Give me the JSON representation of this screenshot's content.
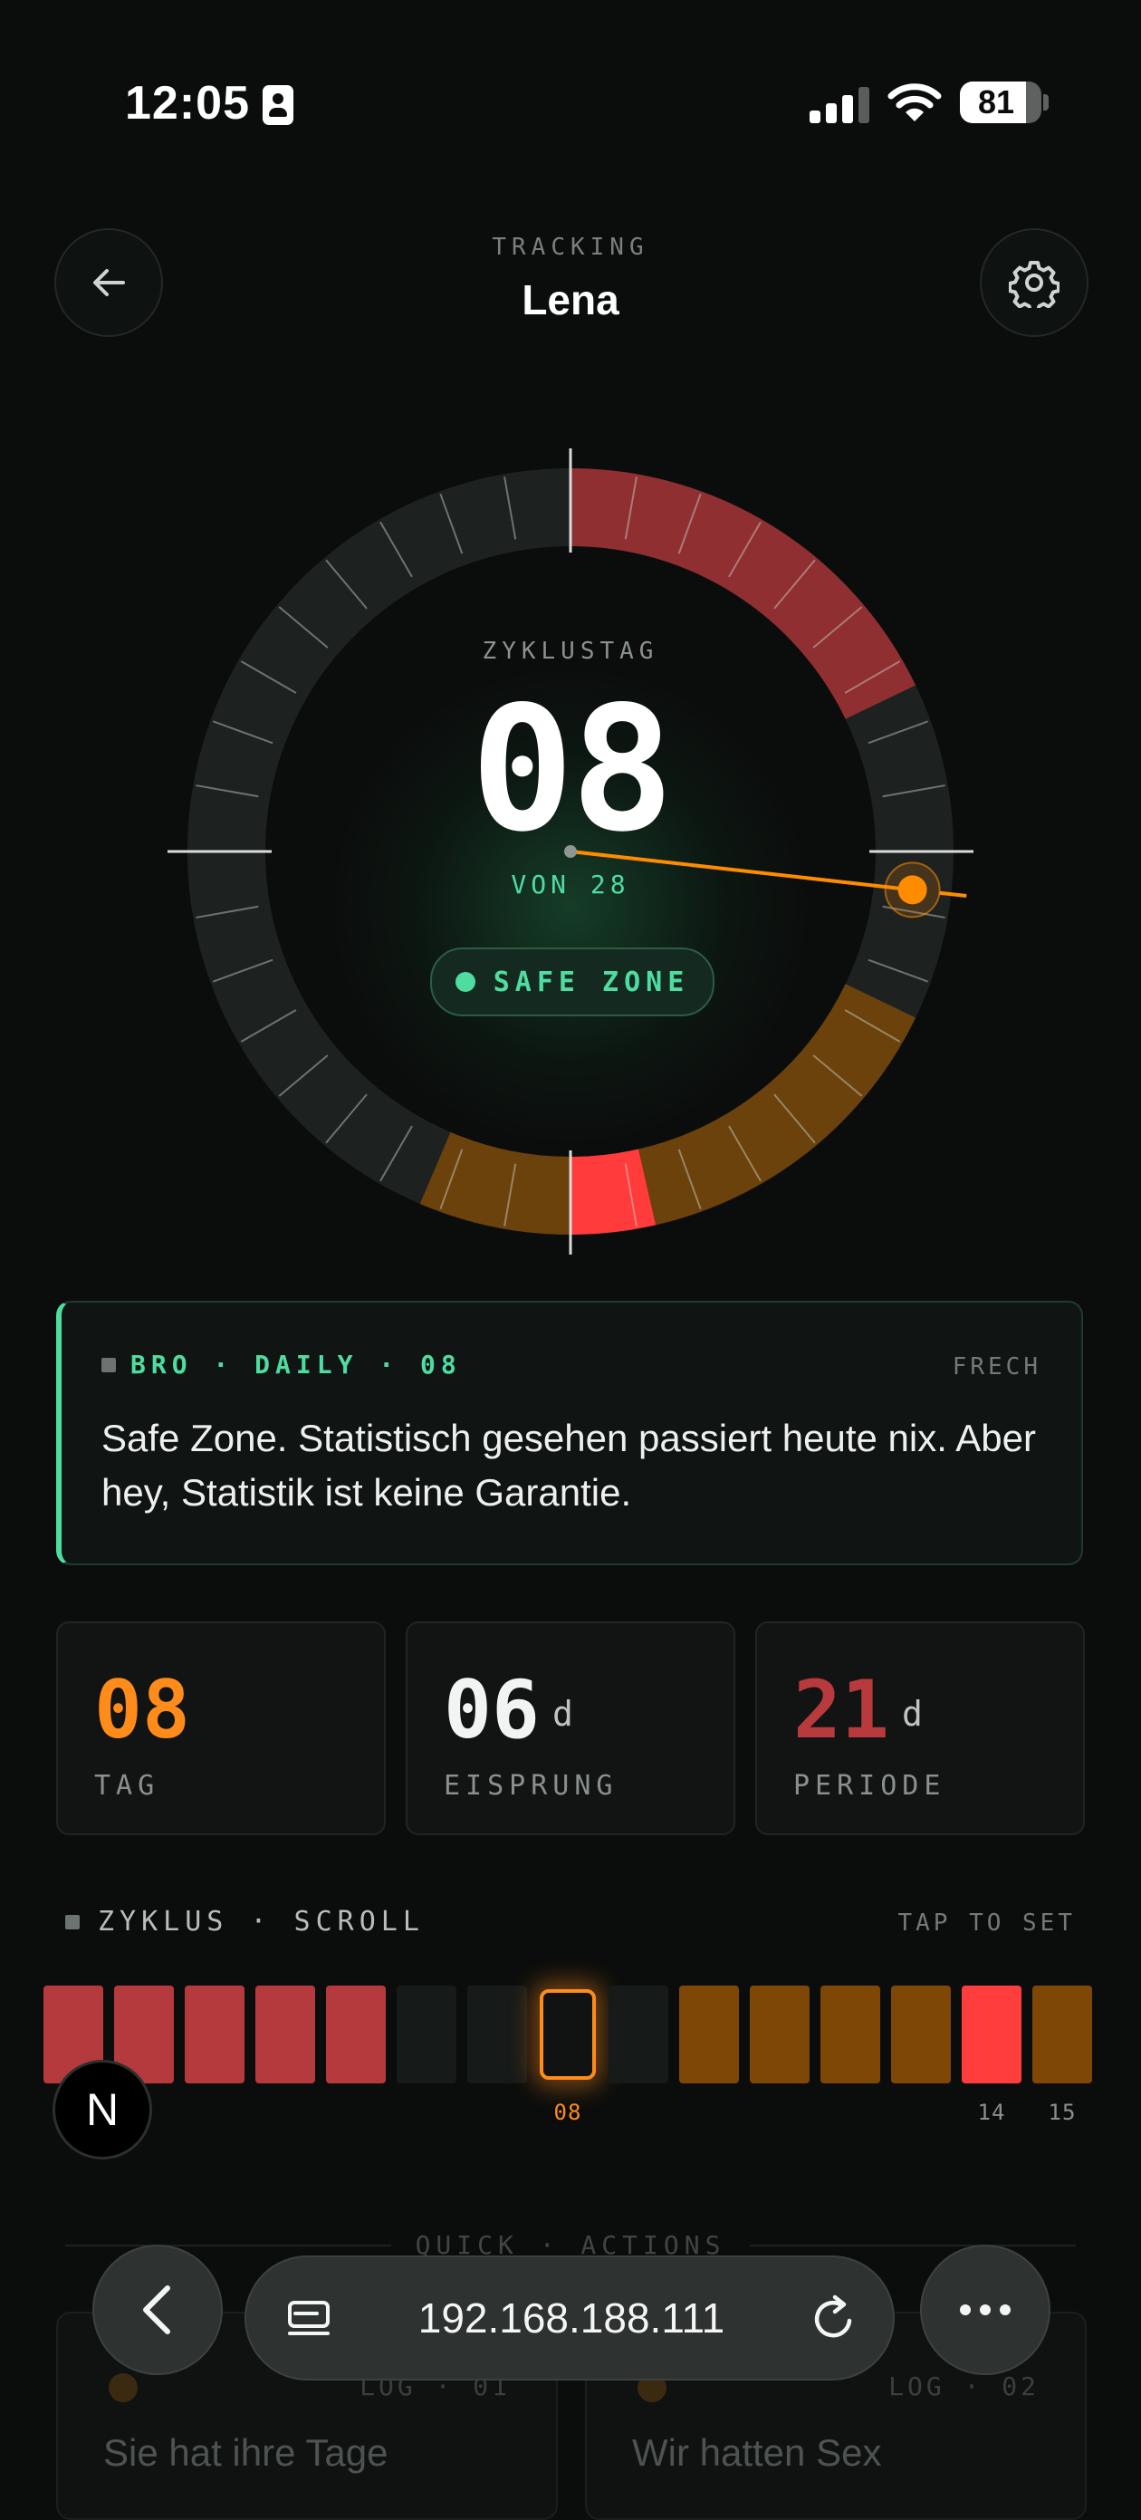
{
  "status_bar": {
    "time": "12:05",
    "battery": "81",
    "battery_level": 0.81,
    "signal_bars": 3
  },
  "header": {
    "eyebrow": "TRACKING",
    "title": "Lena"
  },
  "dial": {
    "label": "ZYKLUSTAG",
    "day": "08",
    "of_text": "VON 28",
    "current_day": 8,
    "cycle_length": 28,
    "zone_label": "SAFE ZONE",
    "colors": {
      "period": "#8f2f31",
      "fertile": "#6b420c",
      "ovulation": "#ff3b3b",
      "track": "#1d2221",
      "indicator": "#ff8c00",
      "safe": "#4fdca0"
    }
  },
  "daily": {
    "tag": "BRO · DAILY · 08",
    "mood": "FRECH",
    "text": "Safe Zone. Statistisch gesehen passiert heute nix. Aber hey, Statistik ist keine Garantie."
  },
  "stats": [
    {
      "value": "08",
      "unit": "",
      "label": "TAG",
      "color": "#ff8c1a"
    },
    {
      "value": "06",
      "unit": "d",
      "label": "EISPRUNG",
      "color": "#f2f4f3"
    },
    {
      "value": "21",
      "unit": "d",
      "label": "PERIODE",
      "color": "#b83a3c"
    }
  ],
  "scroll": {
    "title": "ZYKLUS · SCROLL",
    "hint": "TAP TO SET",
    "days": [
      {
        "type": "period"
      },
      {
        "type": "period"
      },
      {
        "type": "period"
      },
      {
        "type": "period"
      },
      {
        "type": "period"
      },
      {
        "type": "safe"
      },
      {
        "type": "safe"
      },
      {
        "type": "current",
        "label": "08"
      },
      {
        "type": "safe"
      },
      {
        "type": "fertile"
      },
      {
        "type": "fertile"
      },
      {
        "type": "fertile"
      },
      {
        "type": "fertile"
      },
      {
        "type": "ovulation",
        "label": "14"
      },
      {
        "type": "fertile",
        "label": "15"
      }
    ],
    "badge": "N"
  },
  "quick_actions": {
    "title": "QUICK · ACTIONS",
    "items": [
      {
        "log": "LOG · 01",
        "label": "Sie hat ihre Tage"
      },
      {
        "log": "LOG · 02",
        "label": "Wir hatten Sex"
      }
    ]
  },
  "browser": {
    "url": "192.168.188.111"
  }
}
